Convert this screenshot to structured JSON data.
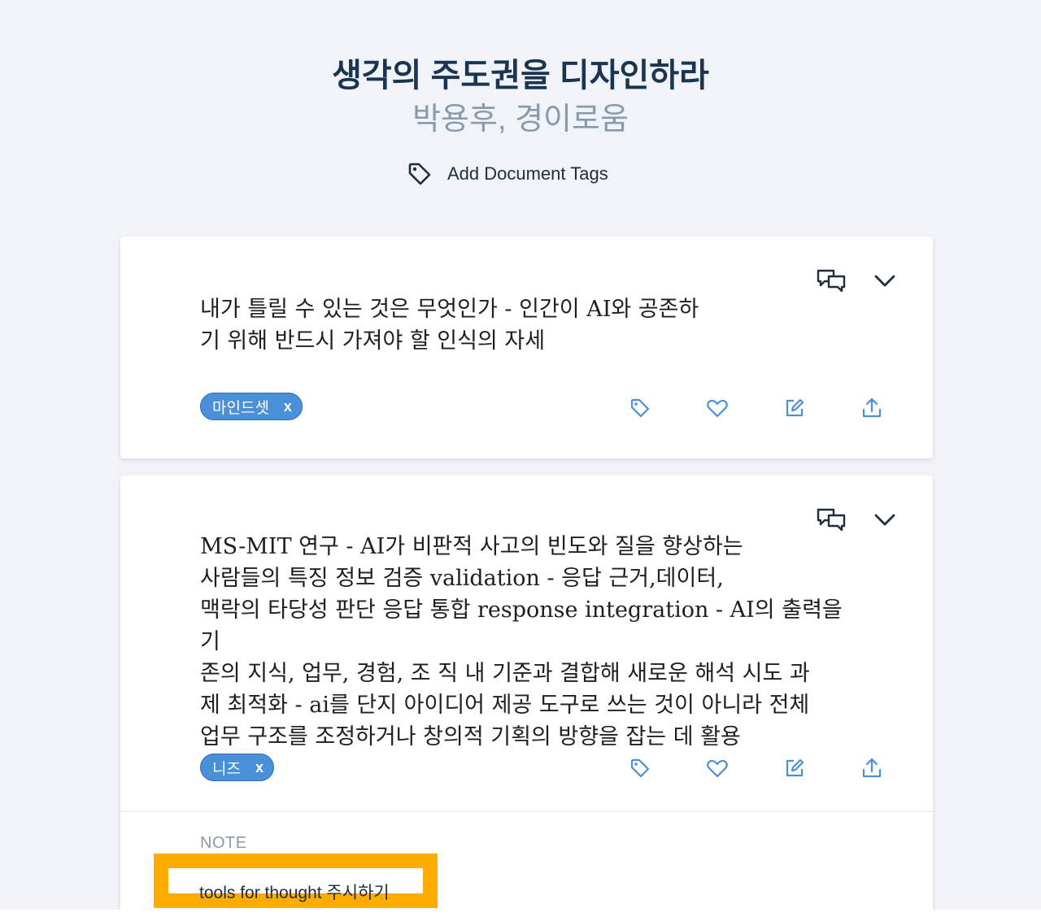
{
  "document": {
    "title": "생각의 주도권을 디자인하라",
    "author": "박용후, 경이로움",
    "add_tags_label": "Add Document Tags"
  },
  "highlights": [
    {
      "text_lines": [
        "내가 틀릴 수 있는 것은 무엇인가 - 인간이 AI와 공존하",
        "기 위해 반드시 가져야 할 인식의 자세"
      ],
      "tags": [
        "마인드셋"
      ],
      "tag_remove_label": "x"
    },
    {
      "text_lines": [
        "MS-MIT 연구 - AI가 비판적 사고의 빈도와 질을 향상하는",
        "사람들의 특징 정보 검증 validation - 응답 근거,데이터,",
        "맥락의 타당성 판단 응답 통합 response integration - AI의 출력을 기",
        "존의 지식, 업무, 경험, 조 직 내 기준과 결합해 새로운 해석 시도 과",
        "제 최적화 - ai를 단지 아이디어 제공 도구로 쓰는 것이 아니라 전체",
        "업무 구조를 조정하거나 창의적 기획의 방향을 잡는 데 활용"
      ],
      "tags": [
        "니즈"
      ],
      "tag_remove_label": "x",
      "note_label": "NOTE",
      "note": "tools for thought 주시하기"
    }
  ],
  "colors": {
    "background": "#f0f3f7",
    "title": "#1b3551",
    "author": "#8a99ab",
    "accent": "#4a90d9",
    "highlight_box": "#ffab00"
  },
  "icons": {
    "tag": "tag-icon",
    "comments": "comments-icon",
    "expand": "chevron-down-icon",
    "favorite": "heart-icon",
    "edit": "edit-icon",
    "share": "share-icon"
  }
}
